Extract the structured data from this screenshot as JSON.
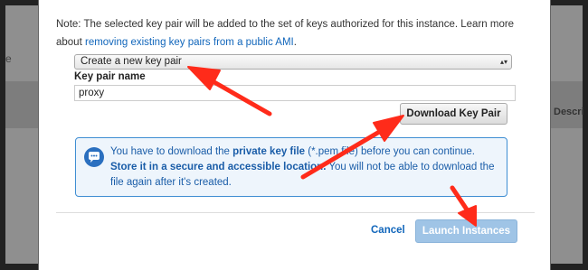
{
  "background": {
    "left_glyph": "e",
    "right_column_header": "Descri"
  },
  "modal": {
    "note": {
      "prefix": "Note: The selected key pair will be added to the set of keys authorized for this instance. Learn more about ",
      "link": "removing existing key pairs from a public AMI",
      "suffix": "."
    },
    "key_pair_select": {
      "selected": "Create a new key pair",
      "caret": "▴▾"
    },
    "key_pair_name": {
      "label": "Key pair name",
      "value": "proxy"
    },
    "download_button": "Download Key Pair",
    "info": {
      "icon": "chat-bubble-icon",
      "part1": "You have to download the ",
      "bold1": "private key file",
      "part2": " (*.pem file) before you can continue. ",
      "bold2": "Store it in a secure and accessible location.",
      "part3": " You will not be able to download the file again after it's created."
    },
    "cancel_label": "Cancel",
    "launch_label": "Launch Instances"
  },
  "colors": {
    "link": "#1166bb",
    "info_border": "#3f8ed3",
    "info_text": "#1a5da8",
    "launch_bg": "#9fc4e6",
    "arrow": "#ff2b1a"
  }
}
